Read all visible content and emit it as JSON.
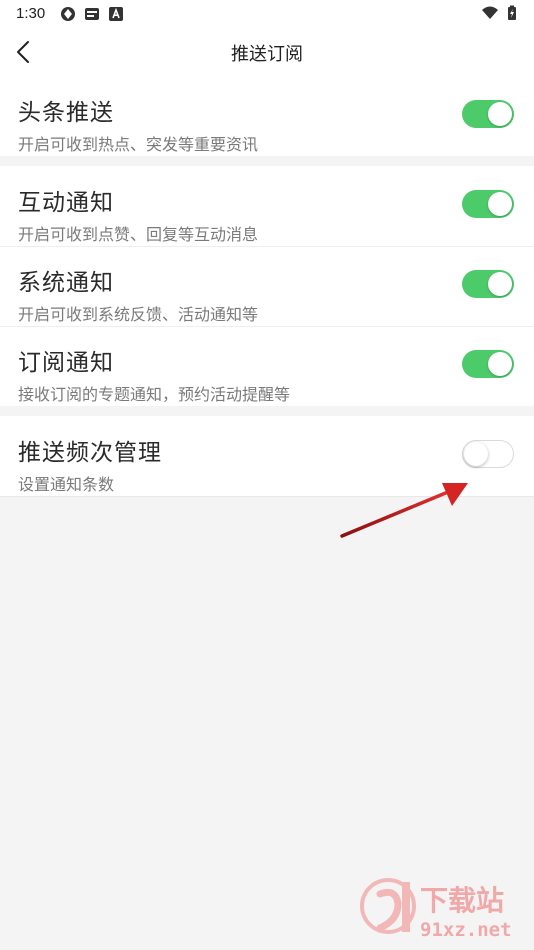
{
  "status_bar": {
    "time": "1:30"
  },
  "header": {
    "title": "推送订阅"
  },
  "settings": {
    "headline": {
      "title": "头条推送",
      "subtitle": "开启可收到热点、突发等重要资讯",
      "enabled": true
    },
    "interaction": {
      "title": "互动通知",
      "subtitle": "开启可收到点赞、回复等互动消息",
      "enabled": true
    },
    "system": {
      "title": "系统通知",
      "subtitle": "开启可收到系统反馈、活动通知等",
      "enabled": true
    },
    "subscription": {
      "title": "订阅通知",
      "subtitle": "接收订阅的专题通知，预约活动提醒等",
      "enabled": true
    },
    "frequency": {
      "title": "推送频次管理",
      "subtitle": "设置通知条数",
      "enabled": false
    }
  },
  "watermark": {
    "logo_text": "下载站",
    "domain": "91xz.net"
  },
  "colors": {
    "toggle_on": "#4dcb6a",
    "arrow": "#d42424"
  }
}
